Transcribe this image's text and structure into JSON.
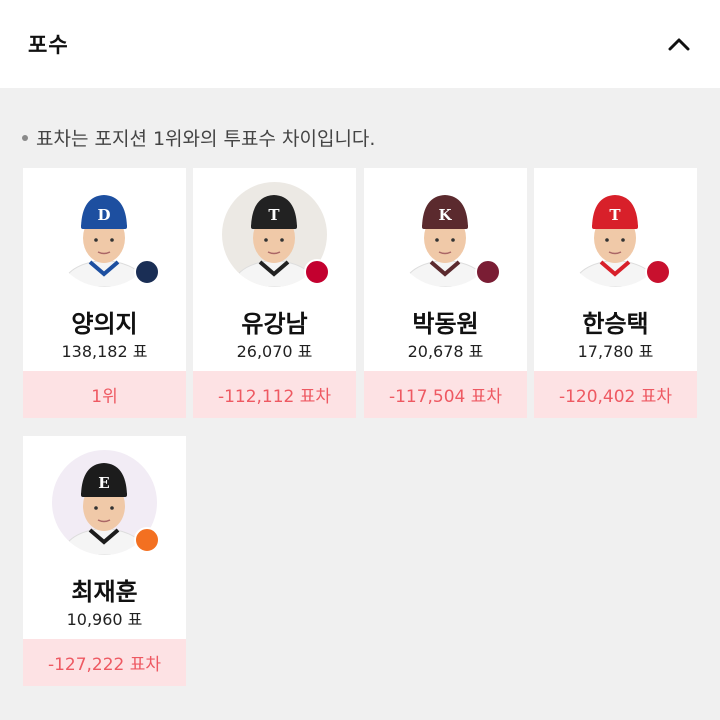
{
  "section": {
    "title": "포수",
    "note": "표차는 포지션 1위와의 투표수 차이입니다."
  },
  "players": [
    {
      "name": "양의지",
      "votes": "138,182 표",
      "gap": "1위",
      "team_badge": "BEARS",
      "cap_color": "#1d4fa0",
      "cap_mark": "D",
      "badge_color": "#1a2e55",
      "bg": "#ffffff"
    },
    {
      "name": "유강남",
      "votes": "26,070 표",
      "gap": "-112,112 표차",
      "team_badge": "TWINS",
      "cap_color": "#222222",
      "cap_mark": "T",
      "badge_color": "#c3002f",
      "bg": "#ece9e4"
    },
    {
      "name": "박동원",
      "votes": "20,678 표",
      "gap": "-117,504 표차",
      "team_badge": "HEROES",
      "cap_color": "#5b2a2e",
      "cap_mark": "K",
      "badge_color": "#7a1d34",
      "bg": "#ffffff"
    },
    {
      "name": "한승택",
      "votes": "17,780 표",
      "gap": "-120,402 표차",
      "team_badge": "TIGERS",
      "cap_color": "#d8202a",
      "cap_mark": "T",
      "badge_color": "#c8102e",
      "bg": "#ffffff"
    },
    {
      "name": "최재훈",
      "votes": "10,960 표",
      "gap": "-127,222 표차",
      "team_badge": "EAGLES",
      "cap_color": "#1c1c1c",
      "cap_mark": "E",
      "badge_color": "#f37021",
      "bg": "#f2ecf5"
    }
  ],
  "icons": {
    "collapse": "chevron-up-icon",
    "bullet": "bullet-dot"
  },
  "colors": {
    "gap_bg": "#fde2e4",
    "gap_text": "#ee5962",
    "page_bg": "#f0f0f0"
  }
}
